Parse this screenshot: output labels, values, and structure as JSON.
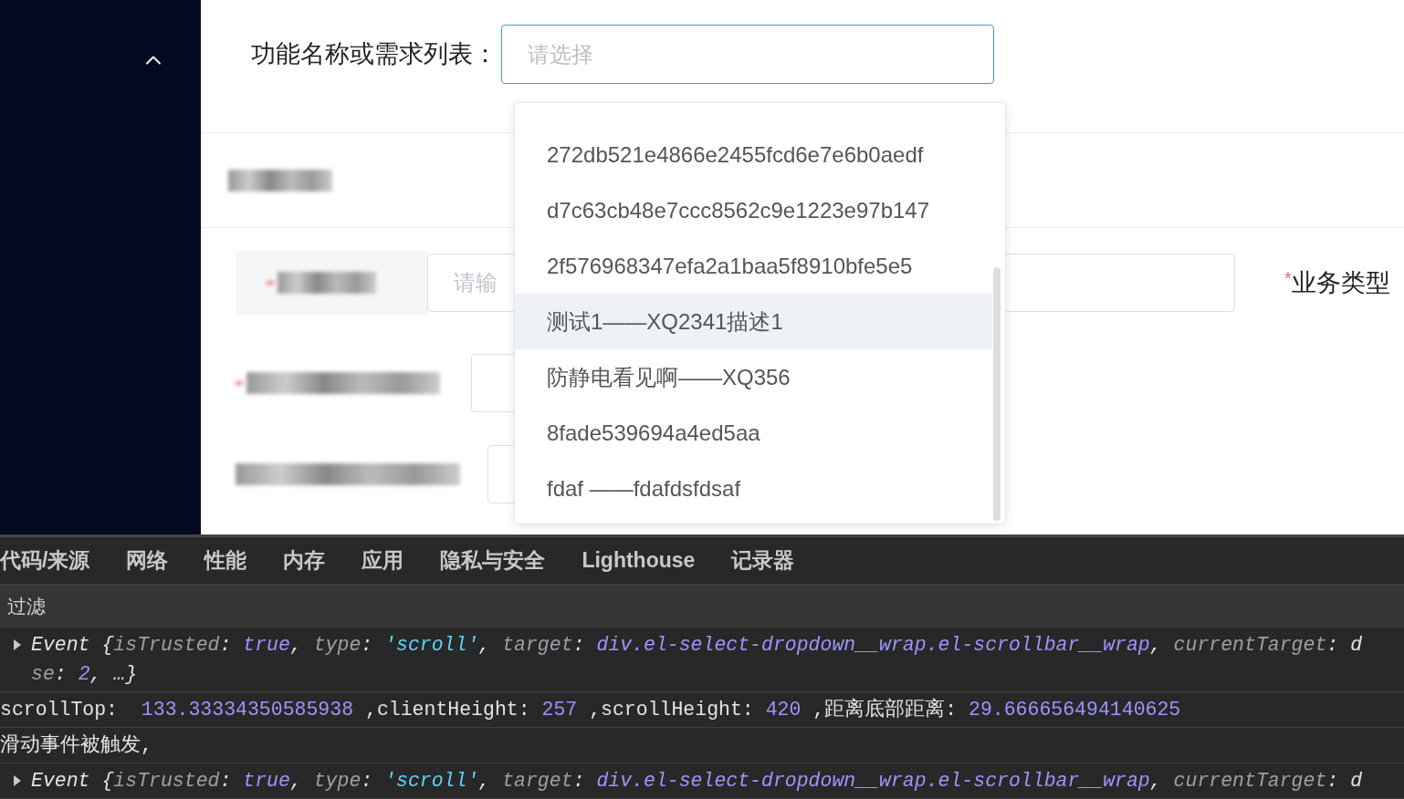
{
  "form": {
    "select_label": "功能名称或需求列表：",
    "select_placeholder": "请选择",
    "input_placeholder": "请输",
    "business_type_label": "业务类型",
    "required_mark": "*"
  },
  "dropdown": {
    "options": [
      {
        "label": "272db521e4866e2455fcd6e7e6b0aedf",
        "highlighted": false
      },
      {
        "label": "d7c63cb48e7ccc8562c9e1223e97b147",
        "highlighted": false
      },
      {
        "label": "2f576968347efa2a1baa5f8910bfe5e5",
        "highlighted": false
      },
      {
        "label": "测试1——XQ2341描述1",
        "highlighted": true
      },
      {
        "label": "防静电看见啊——XQ356",
        "highlighted": false
      },
      {
        "label": "8fade539694a4ed5aa",
        "highlighted": false
      },
      {
        "label": "fdaf ——fdafdsfdsaf",
        "highlighted": false
      }
    ]
  },
  "devtools": {
    "tabs": [
      {
        "label": "代码/来源",
        "selected": false
      },
      {
        "label": "网络",
        "selected": false
      },
      {
        "label": "性能",
        "selected": false
      },
      {
        "label": "内存",
        "selected": false
      },
      {
        "label": "应用",
        "selected": false
      },
      {
        "label": "隐私与安全",
        "selected": false
      },
      {
        "label": "Lighthouse",
        "selected": false
      },
      {
        "label": "记录器",
        "selected": false
      }
    ],
    "filter_label": "过滤",
    "console": [
      {
        "kind": "object",
        "expandable": true,
        "lines": [
          [
            {
              "text": "Event {",
              "kind": "plain"
            },
            {
              "text": "isTrusted",
              "kind": "key"
            },
            {
              "text": ": ",
              "kind": "plain"
            },
            {
              "text": "true",
              "kind": "value"
            },
            {
              "text": ", ",
              "kind": "plain"
            },
            {
              "text": "type",
              "kind": "key"
            },
            {
              "text": ": ",
              "kind": "plain"
            },
            {
              "text": "'scroll'",
              "kind": "string"
            },
            {
              "text": ", ",
              "kind": "plain"
            },
            {
              "text": "target",
              "kind": "key"
            },
            {
              "text": ": ",
              "kind": "plain"
            },
            {
              "text": "div.el-select-dropdown__wrap.el-scrollbar__wrap",
              "kind": "value"
            },
            {
              "text": ", ",
              "kind": "plain"
            },
            {
              "text": "currentTarget",
              "kind": "key"
            },
            {
              "text": ": d",
              "kind": "plain"
            }
          ],
          [
            {
              "text": "se",
              "kind": "key"
            },
            {
              "text": ": ",
              "kind": "plain"
            },
            {
              "text": "2",
              "kind": "value"
            },
            {
              "text": ", …}",
              "kind": "plain"
            }
          ]
        ]
      },
      {
        "kind": "log",
        "lines": [
          [
            {
              "text": "scrollTop:  ",
              "kind": "plain"
            },
            {
              "text": "133.33334350585938",
              "kind": "value"
            },
            {
              "text": " ,clientHeight: ",
              "kind": "plain"
            },
            {
              "text": "257",
              "kind": "value"
            },
            {
              "text": " ,scrollHeight: ",
              "kind": "plain"
            },
            {
              "text": "420",
              "kind": "value"
            },
            {
              "text": " ,距离底部距离: ",
              "kind": "plain"
            },
            {
              "text": "29.666656494140625",
              "kind": "value"
            }
          ]
        ]
      },
      {
        "kind": "log",
        "lines": [
          [
            {
              "text": "滑动事件被触发,",
              "kind": "plain"
            }
          ]
        ]
      },
      {
        "kind": "object",
        "expandable": true,
        "lines": [
          [
            {
              "text": "Event {",
              "kind": "plain"
            },
            {
              "text": "isTrusted",
              "kind": "key"
            },
            {
              "text": ": ",
              "kind": "plain"
            },
            {
              "text": "true",
              "kind": "value"
            },
            {
              "text": ", ",
              "kind": "plain"
            },
            {
              "text": "type",
              "kind": "key"
            },
            {
              "text": ": ",
              "kind": "plain"
            },
            {
              "text": "'scroll'",
              "kind": "string"
            },
            {
              "text": ", ",
              "kind": "plain"
            },
            {
              "text": "target",
              "kind": "key"
            },
            {
              "text": ": ",
              "kind": "plain"
            },
            {
              "text": "div.el-select-dropdown__wrap.el-scrollbar__wrap",
              "kind": "value"
            },
            {
              "text": ", ",
              "kind": "plain"
            },
            {
              "text": "currentTarget",
              "kind": "key"
            },
            {
              "text": ": d",
              "kind": "plain"
            }
          ]
        ]
      }
    ]
  }
}
